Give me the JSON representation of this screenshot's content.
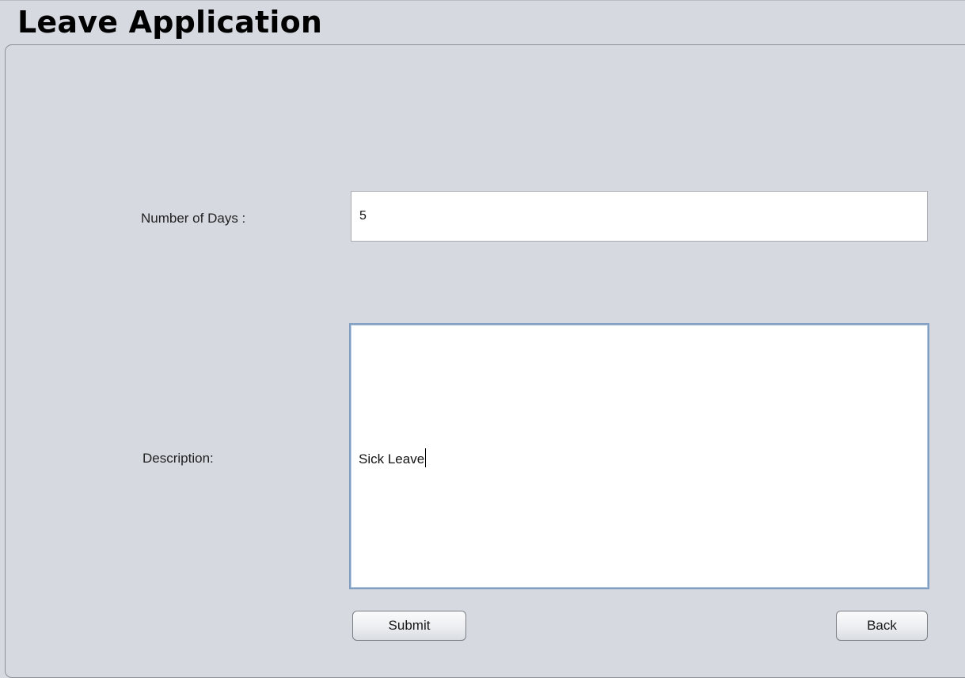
{
  "page": {
    "title": "Leave Application"
  },
  "form": {
    "days_label": "Number of Days :",
    "days_value": "5",
    "description_label": "Description:",
    "description_value": "Sick Leave"
  },
  "actions": {
    "submit_label": "Submit",
    "back_label": "Back"
  },
  "colors": {
    "background": "#d6d9e0",
    "field_background": "#ffffff",
    "focused_border": "#7f9ec2"
  }
}
